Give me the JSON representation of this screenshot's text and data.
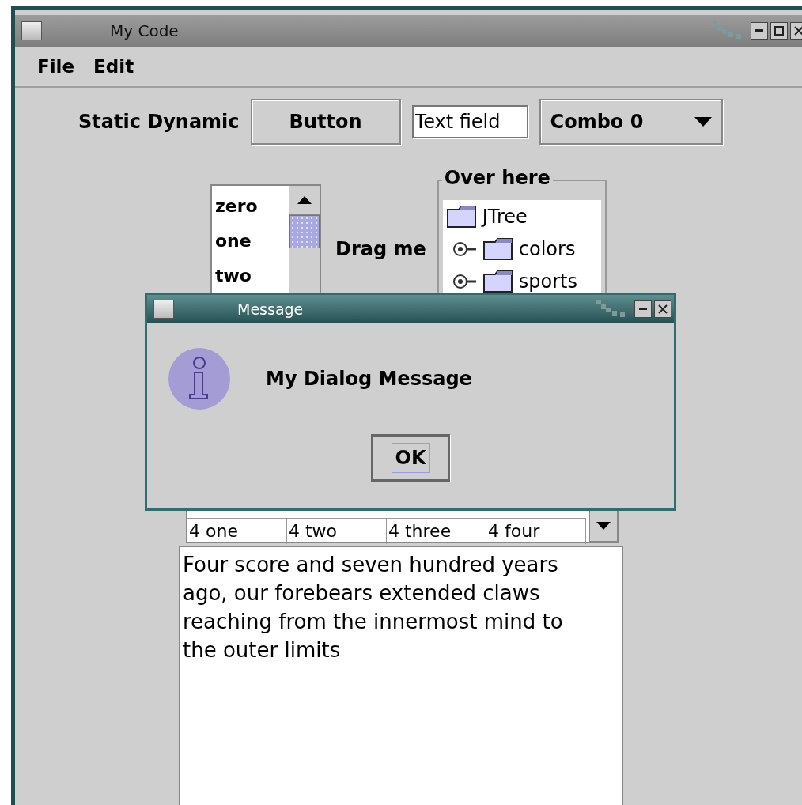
{
  "window": {
    "title": "My Code"
  },
  "menu": [
    "File",
    "Edit"
  ],
  "toolbar": {
    "label": "Static Dynamic",
    "button": "Button",
    "text_field": {
      "value": "Text field"
    },
    "combo": {
      "value": "Combo 0"
    }
  },
  "list": {
    "items": [
      "zero",
      "one",
      "two"
    ]
  },
  "drag_label": "Drag me",
  "group": {
    "title": "Over here",
    "tree": {
      "label": "JTree",
      "children": [
        {
          "label": "colors",
          "expanded": false
        },
        {
          "label": "sports",
          "expanded": false
        }
      ]
    }
  },
  "table": {
    "rows": [
      [
        "4 one",
        "4 two",
        "4 three",
        "4 four"
      ]
    ]
  },
  "text_area": {
    "value": "Four score and seven hundred years ago, our forebears extended claws reaching from the innermost mind to the outer limits"
  },
  "dialog": {
    "title": "Message",
    "message": "My Dialog Message",
    "buttons": [
      {
        "label": "OK",
        "focused": true
      }
    ]
  }
}
